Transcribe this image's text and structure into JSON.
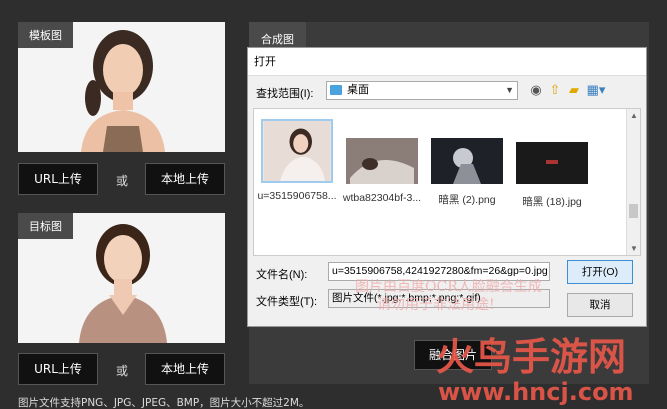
{
  "template_panel": {
    "tab": "模板图",
    "url_btn": "URL上传",
    "or": "或",
    "local_btn": "本地上传"
  },
  "target_panel": {
    "tab": "目标图",
    "url_btn": "URL上传",
    "or": "或",
    "local_btn": "本地上传"
  },
  "merge_panel": {
    "tab": "合成图",
    "merge_btn": "融合图片"
  },
  "dialog": {
    "title": "打开",
    "look_in_label": "查找范围(I):",
    "look_in_value": "桌面",
    "files": [
      {
        "name": "u=3515906758...",
        "selected": true
      },
      {
        "name": "wtba82304bf-3..."
      },
      {
        "name": "暗黑 (2).png"
      },
      {
        "name": "暗黑 (18).jpg"
      }
    ],
    "filename_label": "文件名(N):",
    "filename_value": "u=3515906758,4241927280&fm=26&gp=0.jpg",
    "filetype_label": "文件类型(T):",
    "filetype_value": "图片文件(*.jpg;*.bmp;*.png;*.gif)",
    "open_btn": "打开(O)",
    "cancel_btn": "取消"
  },
  "watermark": {
    "line1": "图片由百度OCR人脸融合生成",
    "line2": "请勿用于非法用途!"
  },
  "footnote": "图片文件支持PNG、JPG、JPEG、BMP，图片大小不超过2M。",
  "logo": {
    "brand": "火鸟手游网",
    "url": "www.hncj.com"
  },
  "colors": {
    "background": "#2e2e2e",
    "panel": "#f4f4f4",
    "button": "#111111",
    "watermark": "#f0a9a9",
    "logo": "#e8584a"
  }
}
